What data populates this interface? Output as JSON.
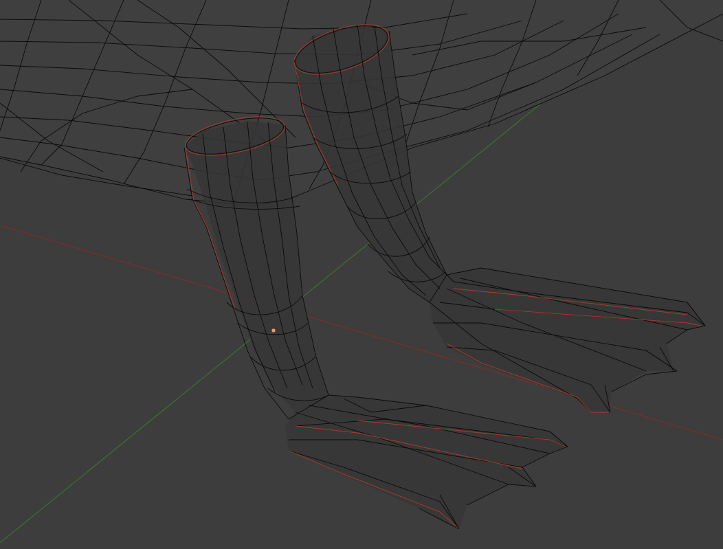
{
  "viewport": {
    "background_color": "#3d3d3d",
    "wire_color": "#0a0a0a",
    "selection_color": "#b33a2a",
    "x_axis_color": "#8a2a2a",
    "y_axis_color": "#3f7a2a",
    "origin_point_color": "#e0a070"
  }
}
